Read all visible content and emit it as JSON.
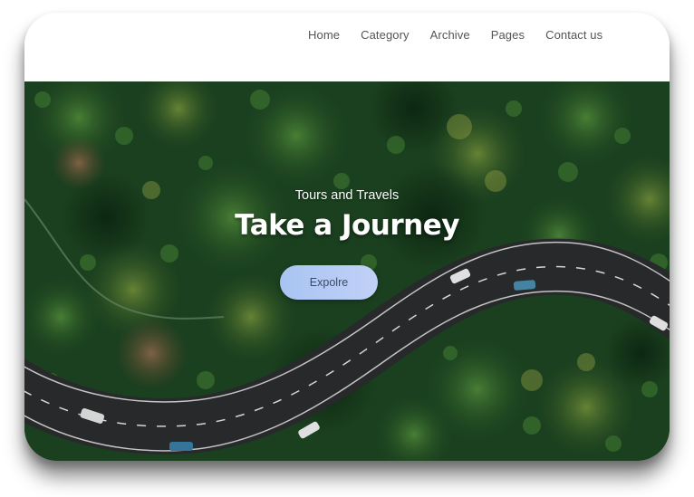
{
  "nav": {
    "items": [
      {
        "label": "Home"
      },
      {
        "label": "Category"
      },
      {
        "label": "Archive"
      },
      {
        "label": "Pages"
      },
      {
        "label": "Contact us"
      }
    ]
  },
  "hero": {
    "subtitle": "Tours and Travels",
    "title": "Take a Journey",
    "button_label": "Expolre",
    "background_image": "aerial-forest-winding-road"
  },
  "colors": {
    "button_gradient_start": "#a9c4f2",
    "button_gradient_end": "#c1d1f7",
    "nav_text": "#555555",
    "forest": "#173a1b",
    "road": "#2b2d2e"
  }
}
